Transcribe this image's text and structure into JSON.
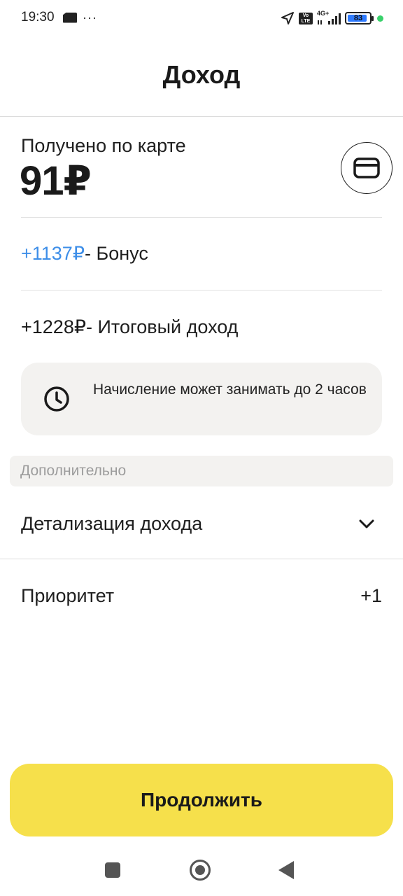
{
  "status_bar": {
    "time": "19:30",
    "dots": "···",
    "network": "4G+",
    "volte": "Vo LTE",
    "battery": "83",
    "icons": [
      "sim-card-icon",
      "navigation-arrow-icon",
      "volte-icon",
      "signal-icon",
      "battery-icon"
    ]
  },
  "header": {
    "title": "Доход"
  },
  "card_income": {
    "label": "Получено по карте",
    "amount": "91₽",
    "card_icon": "credit-card-icon"
  },
  "bonus": {
    "amount": "+1137₽",
    "label": "- Бонус",
    "color": "#3d8ee8"
  },
  "total": {
    "amount": "+1228₽",
    "label": "- Итоговый доход"
  },
  "notice": {
    "icon": "clock-icon",
    "text": "Начисление может занимать до 2 часов"
  },
  "additional": {
    "header": "Дополнительно",
    "detail_label": "Детализация дохода",
    "detail_icon": "chevron-down-icon",
    "priority_label": "Приоритет",
    "priority_value": "+1"
  },
  "continue_button": {
    "label": "Продолжить",
    "color": "#f6e04b"
  },
  "nav": {
    "icons": [
      "recent-apps-icon",
      "home-icon",
      "back-icon"
    ]
  }
}
